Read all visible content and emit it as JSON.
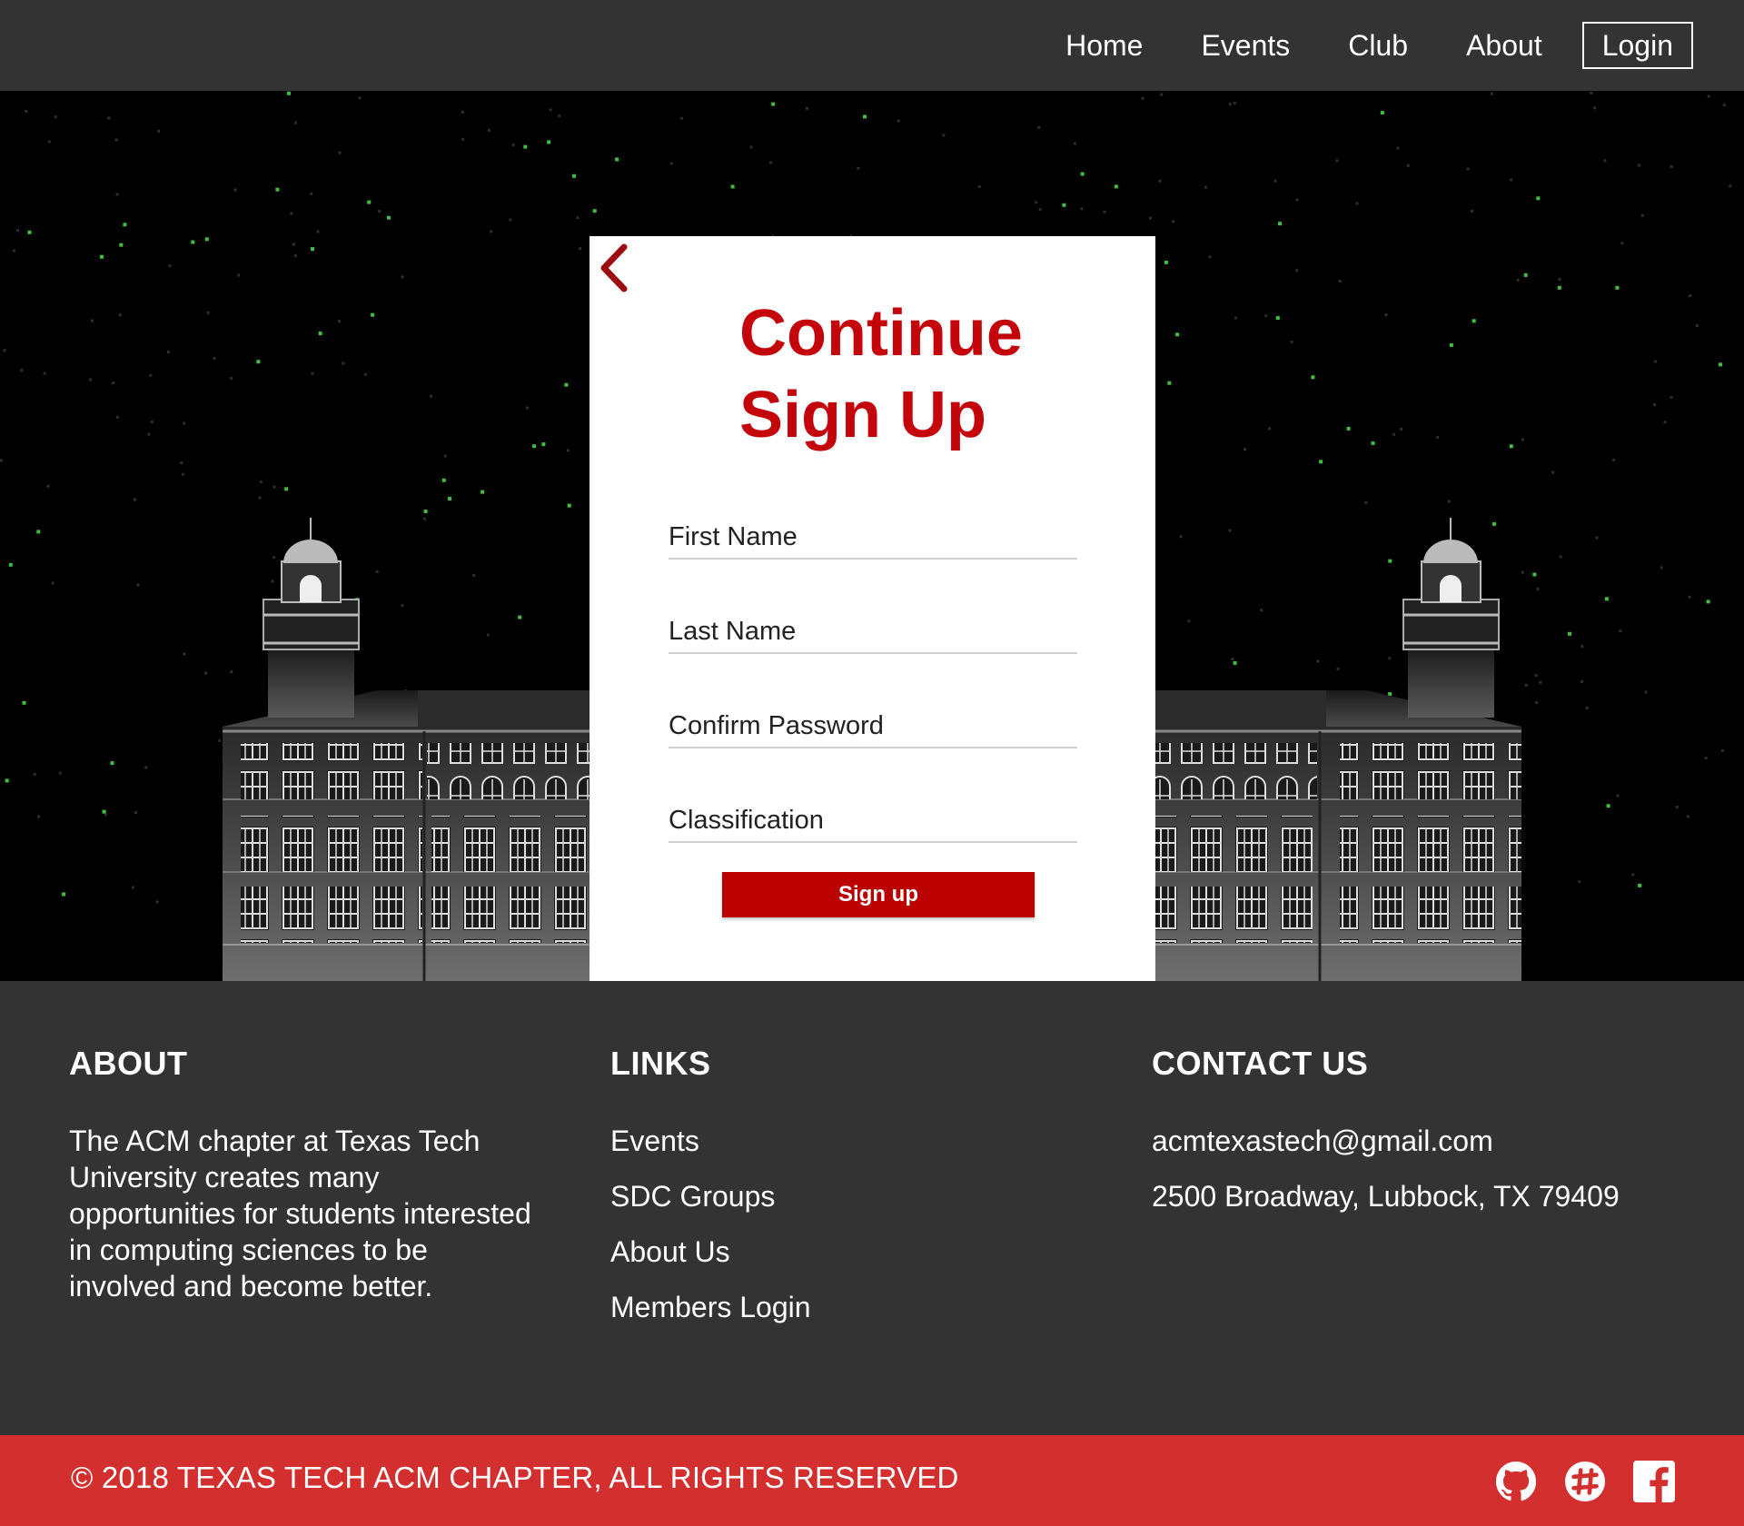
{
  "nav": {
    "items": [
      "Home",
      "Events",
      "Club",
      "About"
    ],
    "login_label": "Login"
  },
  "card": {
    "title_line1": "Continue",
    "title_line2": "Sign Up",
    "fields": {
      "first_name": "First Name",
      "last_name": "Last Name",
      "confirm_password": "Confirm Password",
      "classification": "Classification"
    },
    "submit_label": "Sign up"
  },
  "footer": {
    "about": {
      "heading": "ABOUT",
      "text": "The ACM chapter at Texas Tech University creates many opportunities for students interested in computing sciences to be involved and become better."
    },
    "links": {
      "heading": "LINKS",
      "items": [
        "Events",
        "SDC Groups",
        "About Us",
        "Members Login"
      ]
    },
    "contact": {
      "heading": "CONTACT US",
      "email": "acmtexastech@gmail.com",
      "address": "2500 Broadway, Lubbock, TX 79409"
    }
  },
  "bottom": {
    "copyright": "© 2018 TEXAS TECH ACM CHAPTER, ALL RIGHTS RESERVED",
    "socials": [
      "github-icon",
      "slack-icon",
      "facebook-icon"
    ]
  },
  "colors": {
    "accent": "#c4060c",
    "button": "#bb0000",
    "bottombar": "#d32f2f",
    "dark": "#333333",
    "star_green": "#3fbf3f"
  }
}
